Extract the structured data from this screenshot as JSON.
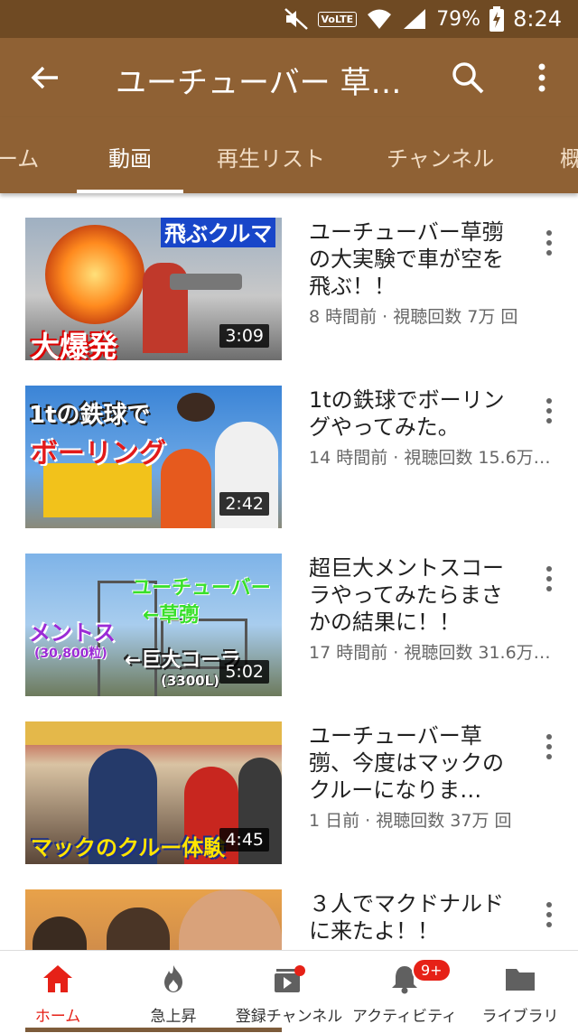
{
  "status_bar": {
    "battery": "79%",
    "time": "8:24",
    "network": "VoLTE"
  },
  "app_bar": {
    "title": "ユーチューバー 草…"
  },
  "tabs": [
    {
      "label": "ーム"
    },
    {
      "label": "動画"
    },
    {
      "label": "再生リスト"
    },
    {
      "label": "チャンネル"
    },
    {
      "label": "概"
    }
  ],
  "videos": [
    {
      "title": "ユーチューバー草彅の大実験で車が空を飛ぶ！！",
      "meta": "8 時間前 · 視聴回数 7万 回",
      "duration": "3:09",
      "thumb_text": [
        "飛ぶクルマ",
        "大爆発"
      ]
    },
    {
      "title": "1tの鉄球でボーリングやってみた。",
      "meta": "14 時間前 · 視聴回数 15.6万…",
      "duration": "2:42",
      "thumb_text": [
        "1tの鉄球で",
        "ボーリング"
      ]
    },
    {
      "title": "超巨大メントスコーラやってみたらまさかの結果に！！",
      "meta": "17 時間前 · 視聴回数 31.6万…",
      "duration": "5:02",
      "thumb_text": [
        "ユーチューバー",
        "←草彅",
        "メントス",
        "(30,800粒)",
        "←巨大コーラ",
        "(3300L)"
      ]
    },
    {
      "title": "ユーチューバー草彅、今度はマックのクルーになりま…",
      "meta": "1 日前 · 視聴回数 37万 回",
      "duration": "4:45",
      "thumb_text": [
        "マックのクルー体験"
      ]
    },
    {
      "title": "３人でマクドナルドに来たよ！！",
      "meta": "",
      "duration": "",
      "thumb_text": []
    }
  ],
  "bottom_nav": [
    {
      "label": "ホーム"
    },
    {
      "label": "急上昇"
    },
    {
      "label": "登録チャンネル"
    },
    {
      "label": "アクティビティ",
      "badge": "9+"
    },
    {
      "label": "ライブラリ"
    }
  ],
  "colors": {
    "accent": "#e62117",
    "appbar": "#8f6134",
    "statusbar": "#6f4a23"
  }
}
